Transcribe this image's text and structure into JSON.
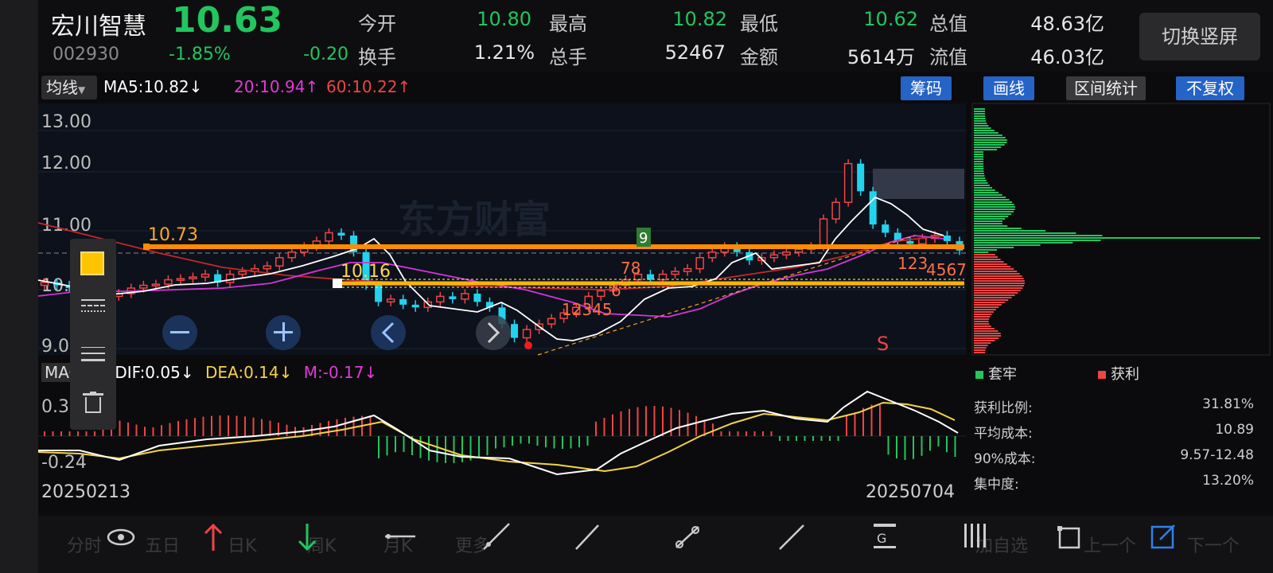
{
  "stock": {
    "name": "宏川智慧",
    "price": "10.63",
    "code": "002930",
    "change_pct": "-1.85%",
    "change": "-0.20"
  },
  "quote": [
    {
      "label": "今开",
      "value": "10.80"
    },
    {
      "label": "最高",
      "value": "10.82"
    },
    {
      "label": "最低",
      "value": "10.62"
    },
    {
      "label": "总值",
      "value": "48.63亿"
    },
    {
      "label": "换手",
      "value": "1.21%"
    },
    {
      "label": "总手",
      "value": "52467"
    },
    {
      "label": "金额",
      "value": "5614万"
    },
    {
      "label": "流值",
      "value": "46.03亿"
    }
  ],
  "switch_button": "切换竖屏",
  "indicator": {
    "ma_select": "均线",
    "ma5": "MA5:10.82",
    "ma20": "20:10.94",
    "ma60": "60:10.22",
    "down_arrow": "↓",
    "up_arrow": "↑"
  },
  "tools": {
    "chips": "筹码",
    "draw": "画线",
    "interval_stats": "区间统计",
    "no_adjust": "不复权"
  },
  "price_axis": [
    "13.00",
    "12.00",
    "11.00",
    "10.",
    "9.00"
  ],
  "annotations": {
    "level1": "10.73",
    "level2": "10.16",
    "nine": "9",
    "s_mark": "S",
    "seq1": "12345",
    "seq2": "78",
    "seq3": "6",
    "seq4": "123",
    "seq5": "4567"
  },
  "chip_panel": {
    "trapped": "套牢",
    "profit": "获利",
    "stats": [
      {
        "label": "获利比例:",
        "value": "31.81%"
      },
      {
        "label": "平均成本:",
        "value": "10.89"
      },
      {
        "label": "90%成本:",
        "value": "9.57-12.48"
      },
      {
        "label": "集中度:",
        "value": "13.20%"
      }
    ]
  },
  "macd": {
    "name": "MACD",
    "dif": "DIF:0.05",
    "dea": "DEA:0.14",
    "m": "M:-0.17",
    "arrow": "↓",
    "axis_top": "0.37",
    "axis_bottom": "-0.24"
  },
  "dates": {
    "start": "20250213",
    "end": "20250704"
  },
  "bottom_tabs": [
    "分时",
    "五日",
    "日K",
    "周K",
    "月K",
    "更多",
    "加自选",
    "上一个",
    "下一个"
  ],
  "watermark": "东方财富",
  "colors": {
    "up": "#ef4444",
    "down": "#22d3ee",
    "green": "#22c55e",
    "orange": "#ff8c00",
    "yellow": "#ffd400",
    "magenta": "#e23ad9"
  }
}
